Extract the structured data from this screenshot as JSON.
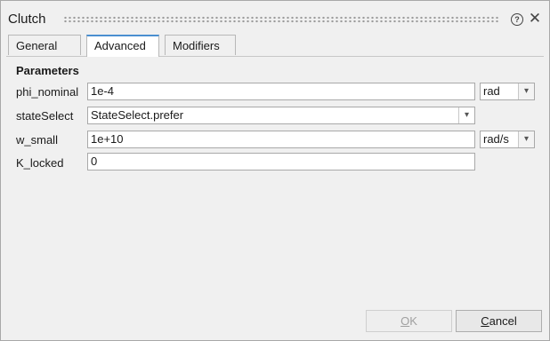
{
  "window": {
    "title": "Clutch",
    "help_icon": "question-circle-icon",
    "close_icon": "close-icon"
  },
  "tabs": [
    {
      "label": "General",
      "active": false
    },
    {
      "label": "Advanced",
      "active": true
    },
    {
      "label": "Modifiers",
      "active": false
    }
  ],
  "parameters": {
    "section_title": "Parameters",
    "rows": [
      {
        "label": "phi_nominal",
        "value": "1e-4",
        "unit": "rad"
      },
      {
        "label": "stateSelect",
        "value": "StateSelect.prefer"
      },
      {
        "label": "w_small",
        "value": "1e+10",
        "unit": "rad/s"
      },
      {
        "label": "K_locked",
        "value": "0"
      }
    ]
  },
  "buttons": {
    "ok": {
      "label_rest": "K",
      "label_ul": "O",
      "enabled": false
    },
    "cancel": {
      "label_ul": "C",
      "label_rest": "ancel",
      "enabled": true
    }
  },
  "colors": {
    "accent_tab": "#4a8fd0",
    "window_bg": "#f0f0f0"
  }
}
